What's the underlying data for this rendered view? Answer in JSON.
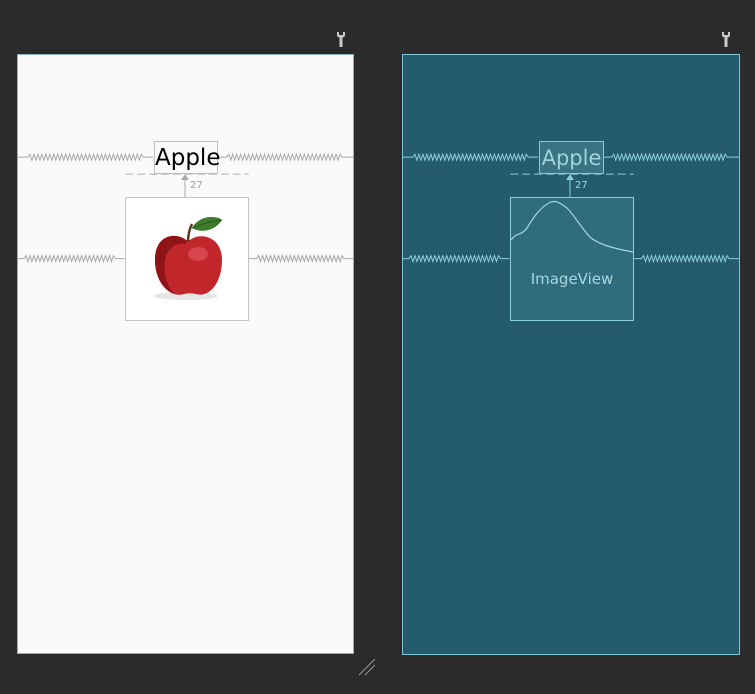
{
  "design": {
    "textview_text": "Apple",
    "margin_value": "27"
  },
  "blueprint": {
    "textview_text": "Apple",
    "margin_value": "27",
    "imageview_label": "ImageView"
  },
  "icons": {
    "design_wrench": "wrench-icon",
    "blueprint_wrench": "wrench-icon",
    "resize": "resize-handle-icon"
  },
  "colors": {
    "background": "#2b2b2c",
    "design_surface": "#fafafa",
    "blueprint_surface": "#245c6c",
    "blueprint_line": "#8ccfdb"
  }
}
